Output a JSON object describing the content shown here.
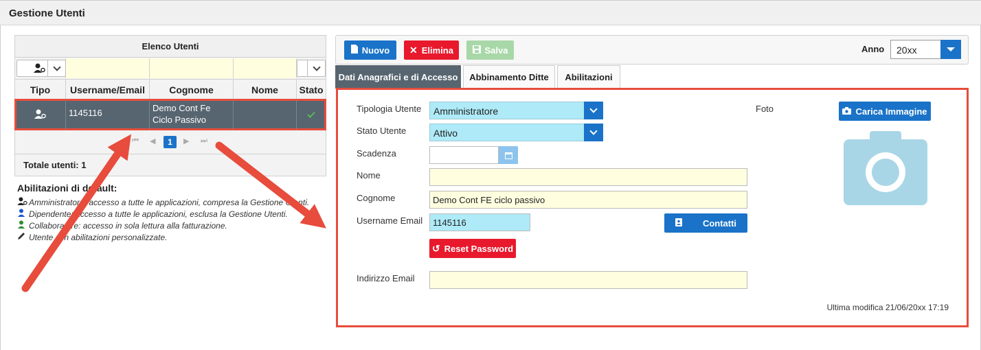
{
  "page": {
    "title": "Gestione Utenti"
  },
  "list": {
    "header": "Elenco Utenti",
    "columns": [
      "Tipo",
      "Username/Email",
      "Cognome",
      "Nome",
      "Stato"
    ],
    "rows": [
      {
        "tipo_icon": "admin-user-icon",
        "username": "1145116",
        "cognome": "Demo Cont Fe Ciclo Passivo",
        "nome": "",
        "stato_icon": "check-icon"
      }
    ],
    "pager": {
      "current_page": "1"
    },
    "total": "Totale utenti: 1"
  },
  "defaults": {
    "heading": "Abilitazioni di default:",
    "items": [
      {
        "icon": "admin-user-icon",
        "text": "Amministratore: accesso a tutte le applicazioni, compresa la Gestione Utenti."
      },
      {
        "icon": "employee-user-icon",
        "text": "Dipendente: accesso a tutte le applicazioni, esclusa la Gestione Utenti."
      },
      {
        "icon": "collaborator-user-icon",
        "text": "Collaboratore: accesso in sola lettura alla fatturazione."
      },
      {
        "icon": "pencil-icon",
        "text": "Utente con abilitazioni personalizzate."
      }
    ]
  },
  "toolbar": {
    "new_label": "Nuovo",
    "delete_label": "Elimina",
    "save_label": "Salva",
    "year_label": "Anno",
    "year_value": "20xx"
  },
  "tabs": [
    "Dati Anagrafici e di Accesso",
    "Abbinamento Ditte",
    "Abilitazioni"
  ],
  "form": {
    "tipologia_label": "Tipologia Utente",
    "tipologia_value": "Amministratore",
    "stato_label": "Stato Utente",
    "stato_value": "Attivo",
    "scadenza_label": "Scadenza",
    "scadenza_value": "",
    "nome_label": "Nome",
    "nome_value": "",
    "cognome_label": "Cognome",
    "cognome_value": "Demo Cont FE ciclo passivo",
    "username_label": "Username Email",
    "username_value": "1145116",
    "contatti_label": "Contatti",
    "reset_label": "Reset Password",
    "email_label": "Indirizzo Email",
    "email_value": "",
    "foto_label": "Foto",
    "upload_label": "Carica Immagine",
    "last_modified": "Ultima modifica 21/06/20xx 17:19"
  },
  "colors": {
    "accent": "#1a73c8",
    "danger": "#e8192c",
    "success": "#5cb85c",
    "highlight": "#e74c3c"
  }
}
